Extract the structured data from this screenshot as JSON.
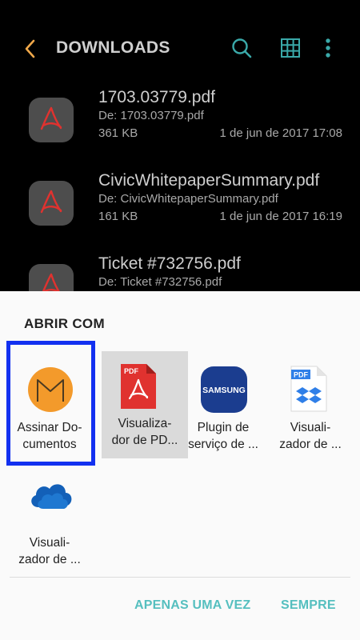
{
  "appbar": {
    "title": "DOWNLOADS",
    "icons": [
      "back-arrow-icon",
      "search-icon",
      "grid-view-icon",
      "more-options-icon"
    ]
  },
  "files": [
    {
      "name": "1703.03779.pdf",
      "from": "De: 1703.03779.pdf",
      "size": "361 KB",
      "date": "1 de jun de 2017 17:08",
      "icon": "pdf-file-icon"
    },
    {
      "name": "CivicWhitepaperSummary.pdf",
      "from": "De: CivicWhitepaperSummary.pdf",
      "size": "161 KB",
      "date": "1 de jun de 2017 16:19",
      "icon": "pdf-file-icon"
    },
    {
      "name": "Ticket #732756.pdf",
      "from": "De: Ticket #732756.pdf",
      "size": "",
      "date": "",
      "icon": "pdf-file-icon"
    }
  ],
  "sheet": {
    "title": "ABRIR COM",
    "apps": [
      {
        "label": "Assinar Do-\ncumentos",
        "icon": "assinar-documentos-icon"
      },
      {
        "label": "Visualiza-\ndor de PD...",
        "icon": "pdf-viewer-icon"
      },
      {
        "label": "Plugin de\nserviço de ...",
        "icon": "samsung-icon"
      },
      {
        "label": "Visuali-\nzador de ...",
        "icon": "dropbox-pdf-icon"
      },
      {
        "label": "Visuali-\nzador de ...",
        "icon": "onedrive-icon"
      }
    ],
    "buttons": {
      "once": "APENAS UMA VEZ",
      "always": "SEMPRE"
    }
  },
  "colors": {
    "accent_orange": "#f0a84a",
    "accent_teal": "#55bfbf",
    "highlight_blue": "#1230f0",
    "pdf_red": "#e0322f"
  }
}
